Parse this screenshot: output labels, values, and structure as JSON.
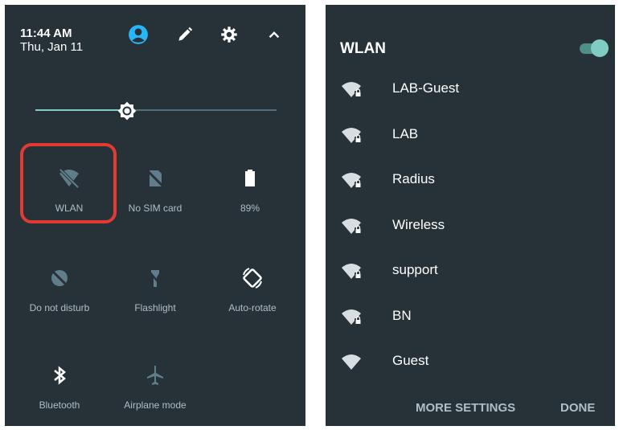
{
  "quick_settings": {
    "time": "11:44 AM",
    "date": "Thu, Jan 11",
    "header_icons": [
      "user-account-icon",
      "edit-pencil-icon",
      "settings-gear-icon",
      "chevron-up-icon"
    ],
    "brightness": {
      "level_fraction": 0.38,
      "accent": "#80cbc4"
    },
    "tiles": [
      {
        "label": "WLAN",
        "icon": "wifi-off-icon",
        "highlighted": true
      },
      {
        "label": "No SIM card",
        "icon": "no-sim-icon"
      },
      {
        "label": "89%",
        "icon": "battery-icon"
      },
      {
        "label": "Do not disturb",
        "icon": "do-not-disturb-off-icon"
      },
      {
        "label": "Flashlight",
        "icon": "flashlight-off-icon"
      },
      {
        "label": "Auto-rotate",
        "icon": "auto-rotate-icon"
      },
      {
        "label": "Bluetooth",
        "icon": "bluetooth-icon"
      },
      {
        "label": "Airplane mode",
        "icon": "airplane-mode-icon"
      }
    ],
    "highlight_color": "#e53935"
  },
  "wlan_panel": {
    "title": "WLAN",
    "toggle_on": true,
    "networks": [
      {
        "name": "LAB-Guest",
        "secured": true
      },
      {
        "name": "LAB",
        "secured": true
      },
      {
        "name": "Radius",
        "secured": true
      },
      {
        "name": "Wireless",
        "secured": true
      },
      {
        "name": "support",
        "secured": true
      },
      {
        "name": "BN",
        "secured": true
      },
      {
        "name": "Guest",
        "secured": false
      }
    ],
    "more_settings_label": "MORE SETTINGS",
    "done_label": "DONE"
  },
  "colors": {
    "panel_bg": "#263238",
    "accent": "#80cbc4",
    "muted_text": "#b0bec5"
  }
}
